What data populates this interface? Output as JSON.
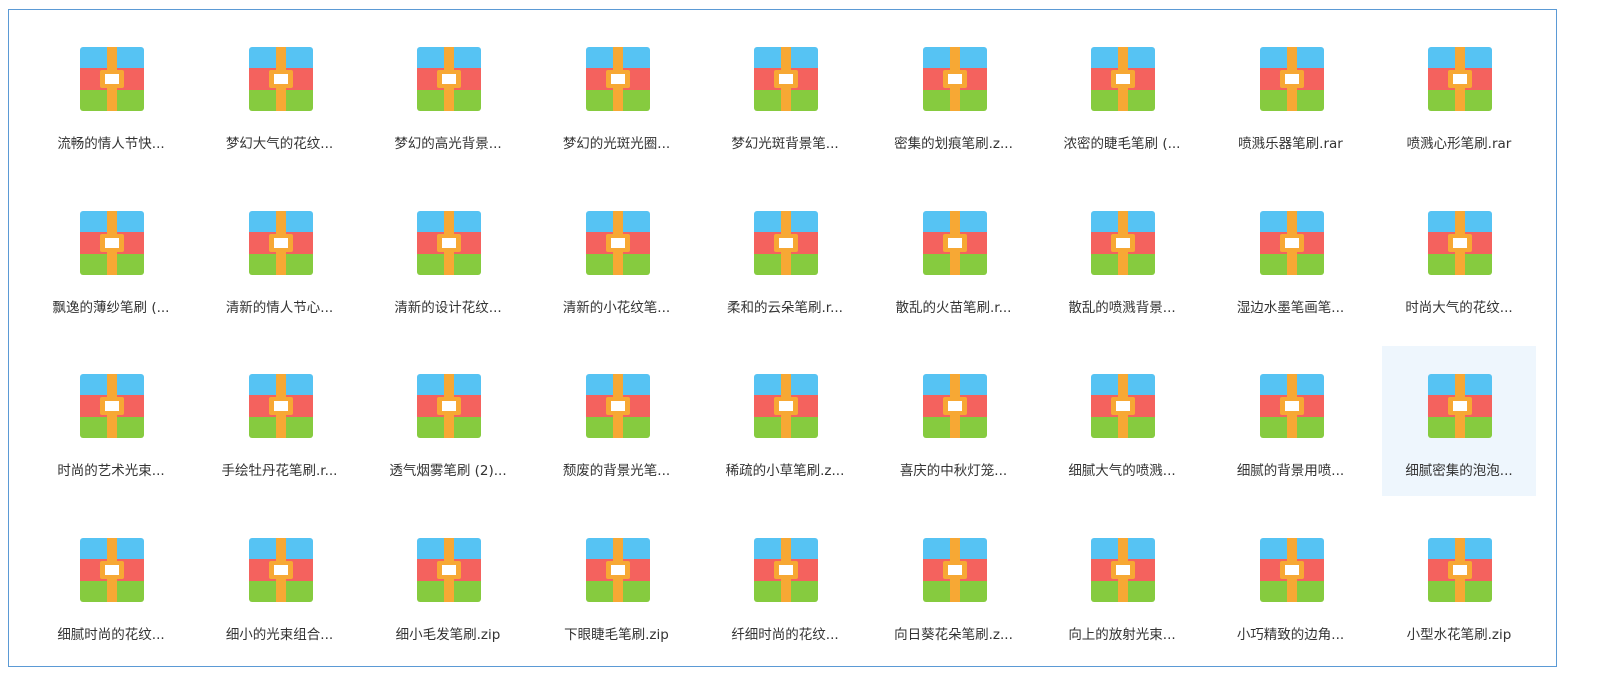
{
  "colors": {
    "frame_border": "#5b9ad5",
    "selected_bg": "#eef6fd",
    "icon_top": "#56c3f3",
    "icon_middle": "#f4625e",
    "icon_bottom": "#86cb3f",
    "icon_zipper": "#f7a834",
    "icon_tag": "#ffffff"
  },
  "icon": "archive-file-icon",
  "selected_index": 26,
  "files": [
    {
      "name": "流畅的情人节快..."
    },
    {
      "name": "梦幻大气的花纹..."
    },
    {
      "name": "梦幻的高光背景..."
    },
    {
      "name": "梦幻的光斑光圈..."
    },
    {
      "name": "梦幻光斑背景笔..."
    },
    {
      "name": "密集的划痕笔刷.z..."
    },
    {
      "name": "浓密的睫毛笔刷 (..."
    },
    {
      "name": "喷溅乐器笔刷.rar"
    },
    {
      "name": "喷溅心形笔刷.rar"
    },
    {
      "name": "飘逸的薄纱笔刷 (..."
    },
    {
      "name": "清新的情人节心..."
    },
    {
      "name": "清新的设计花纹..."
    },
    {
      "name": "清新的小花纹笔..."
    },
    {
      "name": "柔和的云朵笔刷.r..."
    },
    {
      "name": "散乱的火苗笔刷.r..."
    },
    {
      "name": "散乱的喷溅背景..."
    },
    {
      "name": "湿边水墨笔画笔..."
    },
    {
      "name": "时尚大气的花纹..."
    },
    {
      "name": "时尚的艺术光束..."
    },
    {
      "name": "手绘牡丹花笔刷.r..."
    },
    {
      "name": "透气烟雾笔刷 (2)..."
    },
    {
      "name": "颓废的背景光笔..."
    },
    {
      "name": "稀疏的小草笔刷.z..."
    },
    {
      "name": "喜庆的中秋灯笼..."
    },
    {
      "name": "细腻大气的喷溅..."
    },
    {
      "name": "细腻的背景用喷..."
    },
    {
      "name": "细腻密集的泡泡..."
    },
    {
      "name": "细腻时尚的花纹..."
    },
    {
      "name": "细小的光束组合..."
    },
    {
      "name": "细小毛发笔刷.zip"
    },
    {
      "name": "下眼睫毛笔刷.zip"
    },
    {
      "name": "纤细时尚的花纹..."
    },
    {
      "name": "向日葵花朵笔刷.z..."
    },
    {
      "name": "向上的放射光束..."
    },
    {
      "name": "小巧精致的边角..."
    },
    {
      "name": "小型水花笔刷.zip"
    }
  ]
}
